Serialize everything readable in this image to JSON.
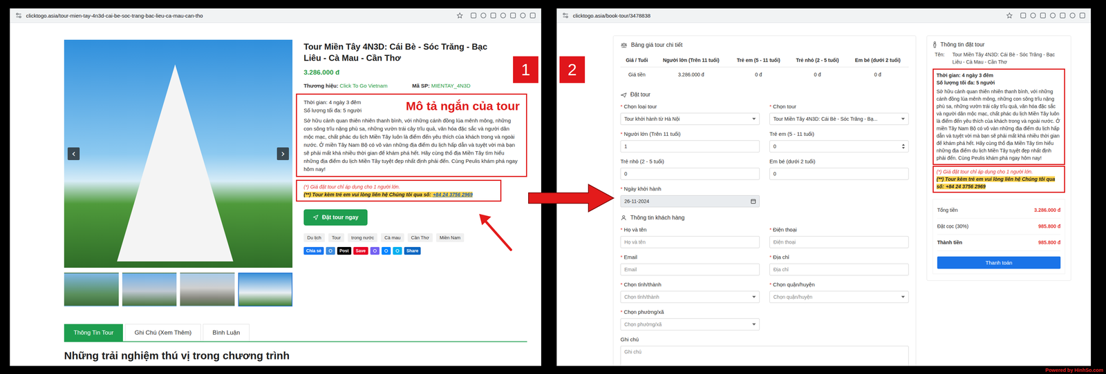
{
  "annotations": {
    "badges": [
      "1",
      "2"
    ],
    "caption": "Mô tả ngắn của tour",
    "watermark": "Powered by HinhSo.com"
  },
  "left_window": {
    "url": "clicktogo.asia/tour-mien-tay-4n3d-cai-be-soc-trang-bac-lieu-ca-mau-can-tho",
    "gallery": {
      "prev": "‹",
      "next": "›",
      "thumbnails": [
        {
          "selected": false
        },
        {
          "selected": false
        },
        {
          "selected": false
        },
        {
          "selected": true
        }
      ]
    },
    "title": "Tour Miền Tây 4N3D: Cái Bè - Sóc Trăng - Bạc Liêu - Cà Mau - Cần Thơ",
    "price": "3.286.000 đ",
    "brand": {
      "label": "Thương hiệu:",
      "value": "Click To Go Vietnam"
    },
    "sku": {
      "label": "Mã SP:",
      "value": "MIENTAY_4N3D"
    },
    "duration": "Thời gian: 4 ngày 3 đêm",
    "capacity": "Số lượng tối đa: 5 người",
    "description": "Sở hữu cảnh quan thiên nhiên thanh bình, với những cánh đồng lúa mênh mông, những con sông trĩu nặng phù sa, những vườn trái cây trĩu quả, văn hóa đặc sắc và người dân mộc mạc, chất phác du lịch Miền Tây luôn là điểm đến yêu thích của khách trong và ngoài nước. Ở miền Tây Nam Bộ có vô vàn những địa điểm du lịch hấp dẫn và tuyệt vời mà bạn sẽ phải mất khá nhiều thời gian để khám phá hết. Hãy cùng thổ địa Miền Tây tìm hiểu những địa điểm du lịch Miền Tây tuyệt đẹp nhất định phải đến. Cùng Peulis khám phá ngay hôm nay!",
    "note_price": "(*) Giá đặt tour chỉ áp dụng cho 1 người lớn.",
    "note_children": "(**) Tour kèm trẻ em vui lòng liên hệ Chúng tôi qua số:",
    "phone": "+84 24 3756 2969",
    "book_button": "Đặt tour ngay",
    "tags": [
      "Du lịch",
      "Tour",
      "trong nước",
      "Cà mau",
      "Cần Thơ",
      "Miền Nam"
    ],
    "share": [
      {
        "label": "Chia sẻ",
        "color": "#1877f2"
      },
      {
        "color": "#3b8be0"
      },
      {
        "label": "Post",
        "color": "#000000"
      },
      {
        "label": "Save",
        "color": "#e60023"
      },
      {
        "color": "#7360f2"
      },
      {
        "color": "#0084ff"
      },
      {
        "color": "#00aff0"
      },
      {
        "label": "Share",
        "color": "#0a66c2"
      }
    ],
    "tabs": [
      {
        "label": "Thông Tin Tour",
        "selected": true
      },
      {
        "label": "Ghi Chú (Xem Thêm)",
        "selected": false
      },
      {
        "label": "Bình Luận",
        "selected": false
      }
    ],
    "heading": "Những trải nghiệm thú vị trong chương trình"
  },
  "right_window": {
    "url": "clicktogo.asia/book-tour/3478838",
    "required_mark": "*",
    "price_table": {
      "title": "Bảng giá tour chi tiết",
      "columns": [
        "Giá / Tuổi",
        "Người lớn (Trên 11 tuổi)",
        "Trẻ em (5 - 11 tuổi)",
        "Trẻ nhỏ (2 - 5 tuổi)",
        "Em bé (dưới 2 tuổi)"
      ],
      "rows": [
        [
          "Giá tiền",
          "3.286.000 đ",
          "0 đ",
          "0 đ",
          "0 đ"
        ]
      ]
    },
    "booking": {
      "title": "Đặt tour",
      "fields": [
        {
          "label": "Chọn loại tour",
          "required": true,
          "kind": "select",
          "disabled": false,
          "value": "Tour khởi hành từ Hà Nội"
        },
        {
          "label": "Chọn tour",
          "required": true,
          "kind": "select",
          "disabled": false,
          "value": "Tour Miền Tây 4N3D: Cái Bè - Sóc Trăng - Bạ..."
        },
        {
          "label": "Người lớn (Trên 11 tuổi)",
          "required": true,
          "kind": "text",
          "disabled": false,
          "value": "1"
        },
        {
          "label": "Trẻ em (5 - 11 tuổi)",
          "required": false,
          "kind": "number",
          "disabled": false,
          "value": "0"
        },
        {
          "label": "Trẻ nhỏ (2 - 5 tuổi)",
          "required": false,
          "kind": "text",
          "disabled": false,
          "value": "0"
        },
        {
          "label": "Em bé (dưới 2 tuổi)",
          "required": false,
          "kind": "text",
          "disabled": false,
          "value": "0"
        },
        {
          "label": "Ngày khởi hành",
          "required": true,
          "kind": "date",
          "disabled": true,
          "value": "26-11-2024"
        }
      ]
    },
    "customer": {
      "title": "Thông tin khách hàng",
      "fields": [
        {
          "label": "Họ và tên",
          "required": true,
          "kind": "text",
          "disabled": false,
          "placeholder": "Họ và tên"
        },
        {
          "label": "Điện thoại",
          "required": true,
          "kind": "text",
          "disabled": false,
          "placeholder": "Điện thoại"
        },
        {
          "label": "Email",
          "required": true,
          "kind": "text",
          "disabled": false,
          "placeholder": "Email"
        },
        {
          "label": "Địa chỉ",
          "required": true,
          "kind": "text",
          "disabled": false,
          "placeholder": "Địa chỉ"
        },
        {
          "label": "Chọn tỉnh/thành",
          "required": true,
          "kind": "select",
          "disabled": false,
          "placeholder": "Chọn tỉnh/thành"
        },
        {
          "label": "Chọn quận/huyện",
          "required": true,
          "kind": "select",
          "disabled": false,
          "placeholder": "Chọn quận/huyện"
        },
        {
          "label": "Chọn phường/xã",
          "required": true,
          "kind": "select",
          "disabled": false,
          "placeholder": "Chọn phường/xã"
        },
        {
          "label": "Ghi chú",
          "required": false,
          "kind": "textarea",
          "disabled": false,
          "placeholder": "Ghi chú"
        }
      ]
    },
    "summary": {
      "title": "Thông tin đặt tour",
      "name_label": "Tên:",
      "name": "Tour Miền Tây 4N3D: Cái Bè - Sóc Trăng - Bạc Liêu - Cà Mau - Cần Thơ",
      "duration": "Thời gian: 4 ngày 3 đêm",
      "capacity": "Số lượng tối đa: 5 người",
      "description": "Sở hữu cảnh quan thiên nhiên thanh bình, với những cánh đồng lúa mênh mông, những con sông trĩu nặng phù sa, những vườn trái cây trĩu quả, văn hóa đặc sắc và người dân mộc mạc, chất phác du lịch Miền Tây luôn là điểm đến yêu thích của khách trong và ngoài nước. Ở miền Tây Nam Bộ có vô vàn những địa điểm du lịch hấp dẫn và tuyệt vời mà bạn sẽ phải mất khá nhiều thời gian để khám phá hết. Hãy cùng thổ địa Miền Tây tìm hiểu những địa điểm du lịch Miền Tây tuyệt đẹp nhất định phải đến. Cùng Peulis khám phá ngay hôm nay!",
      "note_price": "(*) Giá đặt tour chỉ áp dụng cho 1 người lớn.",
      "note_children": "(**) Tour kèm trẻ em vui lòng liên hệ Chúng tôi qua số:",
      "phone": "+84 24 3756 2969",
      "totals": [
        {
          "label": "Tổng tiền",
          "value": "3.286.000 đ",
          "strong": false
        },
        {
          "label": "Đặt cọc (30%)",
          "value": "985.800 đ",
          "strong": false
        },
        {
          "label": "Thành tiền",
          "value": "985.800 đ",
          "strong": true
        }
      ],
      "pay_button": "Thanh toán"
    }
  }
}
